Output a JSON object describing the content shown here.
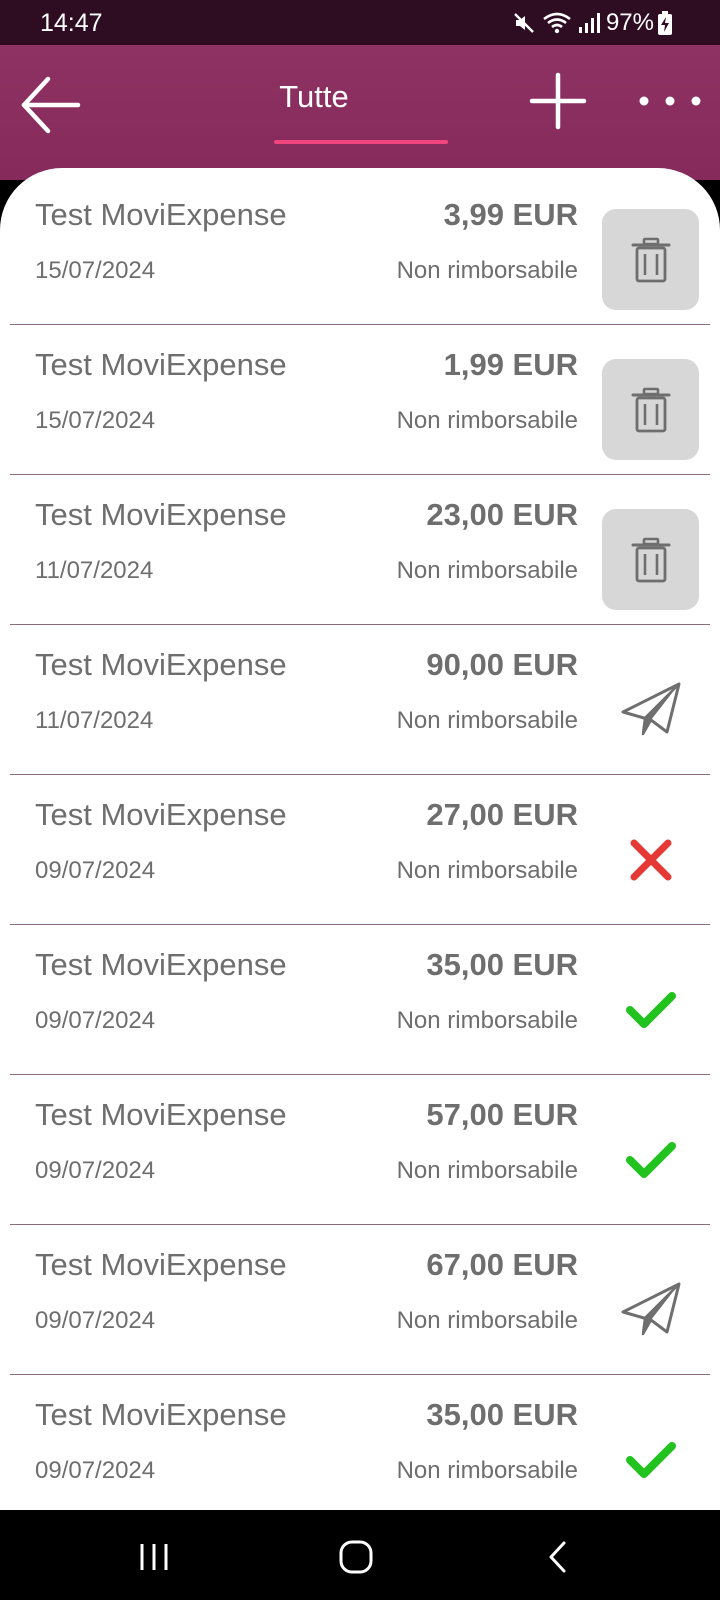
{
  "status_bar": {
    "time": "14:47",
    "battery": "97%",
    "icons": [
      "mute-icon",
      "wifi-icon",
      "signal-icon",
      "battery-charging-icon"
    ]
  },
  "header": {
    "back_icon": "arrow-left-icon",
    "tab_label": "Tutte",
    "add_icon": "plus-icon",
    "more_icon": "more-horizontal-icon",
    "accent_color": "#8e3263",
    "indicator_color": "#f0457f"
  },
  "expenses": [
    {
      "title": "Test MoviExpense",
      "amount": "3,99 EUR",
      "date": "15/07/2024",
      "status": "Non rimborsabile",
      "action": "delete"
    },
    {
      "title": "Test MoviExpense",
      "amount": "1,99 EUR",
      "date": "15/07/2024",
      "status": "Non rimborsabile",
      "action": "delete"
    },
    {
      "title": "Test MoviExpense",
      "amount": "23,00 EUR",
      "date": "11/07/2024",
      "status": "Non rimborsabile",
      "action": "delete"
    },
    {
      "title": "Test MoviExpense",
      "amount": "90,00 EUR",
      "date": "11/07/2024",
      "status": "Non rimborsabile",
      "action": "sent"
    },
    {
      "title": "Test MoviExpense",
      "amount": "27,00 EUR",
      "date": "09/07/2024",
      "status": "Non rimborsabile",
      "action": "rejected"
    },
    {
      "title": "Test MoviExpense",
      "amount": "35,00 EUR",
      "date": "09/07/2024",
      "status": "Non rimborsabile",
      "action": "approved"
    },
    {
      "title": "Test MoviExpense",
      "amount": "57,00 EUR",
      "date": "09/07/2024",
      "status": "Non rimborsabile",
      "action": "approved"
    },
    {
      "title": "Test MoviExpense",
      "amount": "67,00 EUR",
      "date": "09/07/2024",
      "status": "Non rimborsabile",
      "action": "sent"
    },
    {
      "title": "Test MoviExpense",
      "amount": "35,00 EUR",
      "date": "09/07/2024",
      "status": "Non rimborsabile",
      "action": "approved"
    }
  ],
  "colors": {
    "rejected": "#e53935",
    "approved": "#22c21f",
    "delete_bg": "#d6d7d6"
  },
  "nav_bar": {
    "icons": [
      "recent-apps-icon",
      "home-icon",
      "back-icon"
    ]
  }
}
